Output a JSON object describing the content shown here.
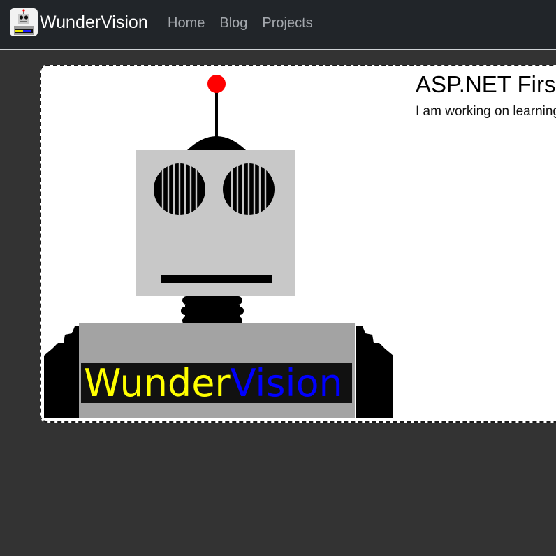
{
  "brand": {
    "name": "WunderVision",
    "logo_icon": "robot-logo-icon"
  },
  "nav": {
    "items": [
      {
        "label": "Home"
      },
      {
        "label": "Blog"
      },
      {
        "label": "Projects"
      }
    ]
  },
  "card": {
    "title": "ASP.NET First",
    "text": "I am working on learning",
    "image": {
      "icon": "robot-illustration",
      "banner_left": "Wunder",
      "banner_right": "Vision"
    }
  },
  "colors": {
    "navbar_bg": "#212529",
    "page_bg": "#333333",
    "banner_left": "#ffff00",
    "banner_right": "#0000ff",
    "antenna_tip": "#ff0000"
  }
}
